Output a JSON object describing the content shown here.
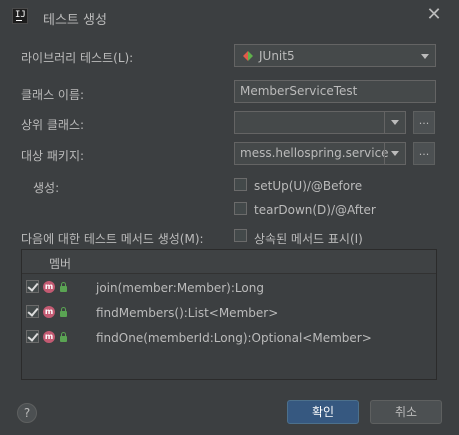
{
  "window": {
    "title": "테스트 생성",
    "app_icon_label": "IJ",
    "close_glyph": "✕"
  },
  "form": {
    "library_label": "라이브러리 테스트(L):",
    "library_value": "JUnit5",
    "class_name_label": "클래스 이름:",
    "class_name_value": "MemberServiceTest",
    "superclass_label": "상위 클래스:",
    "superclass_value": "",
    "package_label": "대상 패키지:",
    "package_value": "mess.hellospring.service",
    "browse_glyph": "...",
    "generate_label": "생성:",
    "setup_label": "setUp(U)/@Before",
    "setup_checked": false,
    "teardown_label": "tearDown(D)/@After",
    "teardown_checked": false,
    "methods_label": "다음에 대한 테스트 메서드 생성(M):",
    "inherited_label": "상속된 메서드 표시(I)",
    "inherited_checked": false
  },
  "members": {
    "header": "멤버",
    "method_icon_letter": "m",
    "items": [
      {
        "signature": "join(member:Member):Long",
        "checked": true
      },
      {
        "signature": "findMembers():List<Member>",
        "checked": true
      },
      {
        "signature": "findOne(memberId:Long):Optional<Member>",
        "checked": true
      }
    ]
  },
  "footer": {
    "help_glyph": "?",
    "ok_label": "확인",
    "cancel_label": "취소"
  },
  "colors": {
    "background": "#3c3f41",
    "field_bg": "#45494a",
    "ok_button": "#365880",
    "method_icon": "#c35a72",
    "access_icon": "#5aa453"
  }
}
